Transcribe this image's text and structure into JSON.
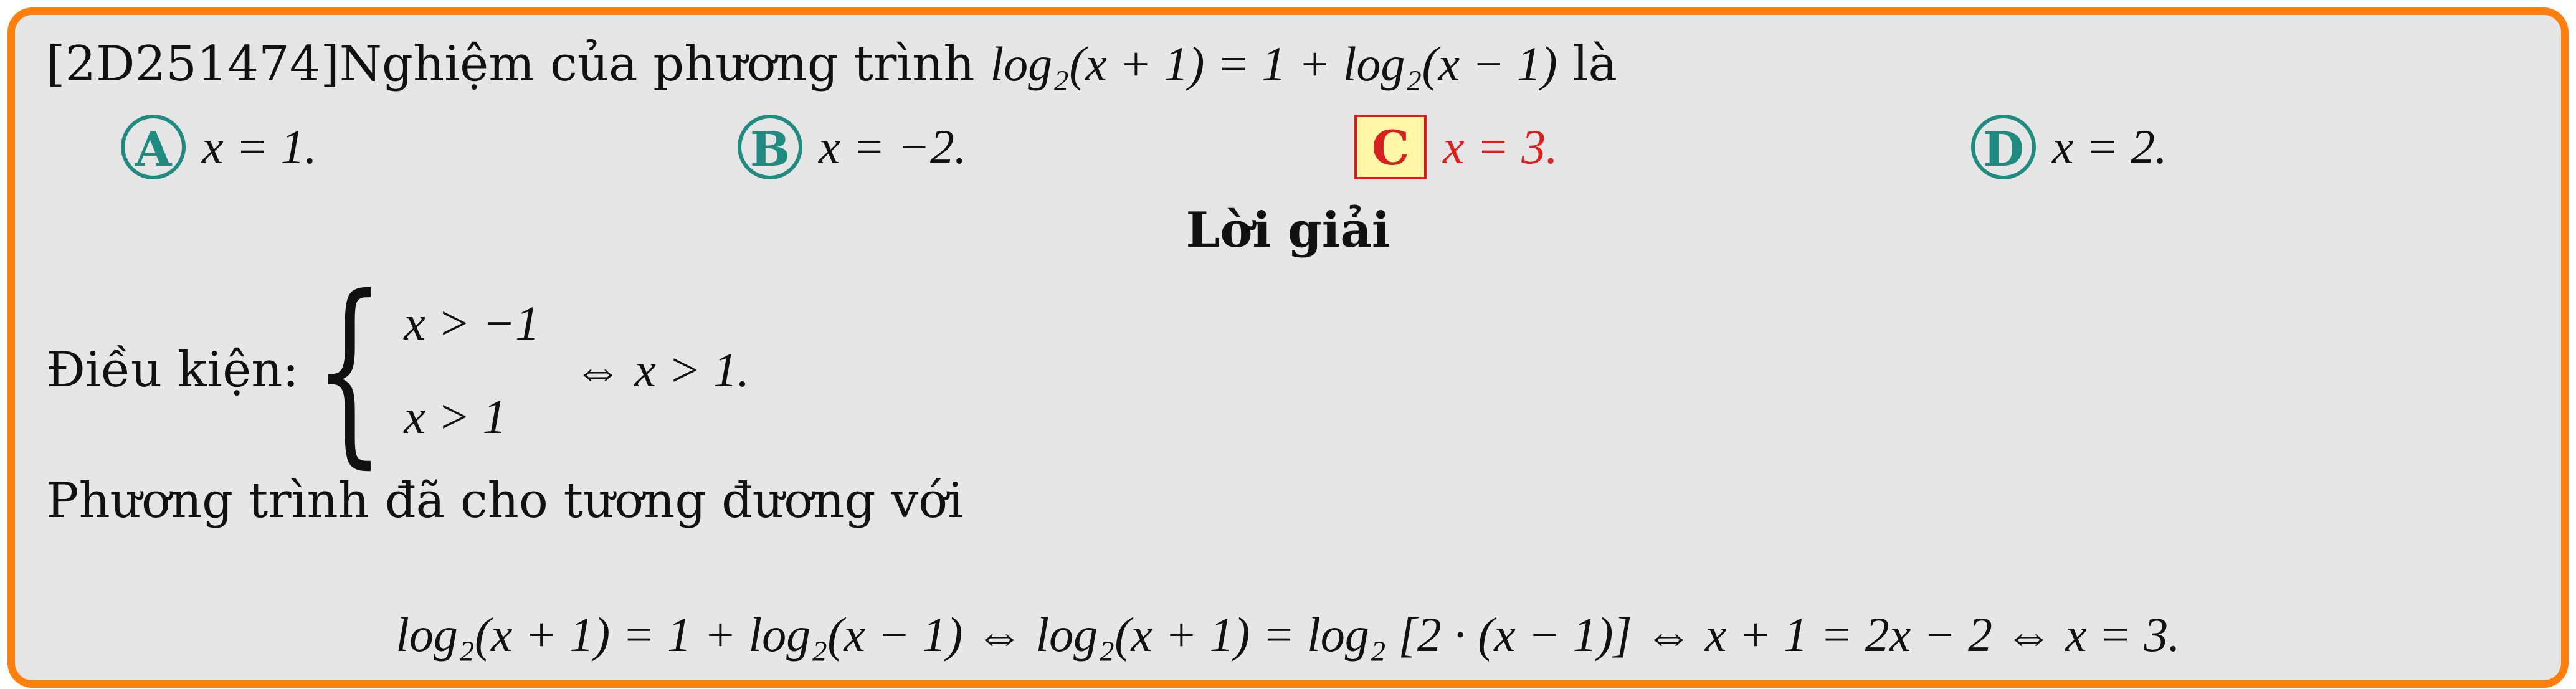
{
  "question": {
    "prefix": "[2D251474]Nghiệm của phương trình ",
    "eq": "log₂(x + 1) = 1 + log₂(x − 1)",
    "suffix": " là"
  },
  "options": [
    {
      "label": "A",
      "text": "x = 1."
    },
    {
      "label": "B",
      "text": "x = −2."
    },
    {
      "label": "C",
      "text": "x = 3."
    },
    {
      "label": "D",
      "text": "x = 2."
    }
  ],
  "solution": {
    "title": "Lời giải",
    "condition_label": "Điều kiện:",
    "conditions": [
      "x > −1",
      "x > 1"
    ],
    "condition_result": "⇔ x > 1.",
    "equivalent_text": "Phương trình đã cho tương đương với",
    "final_eq": "log₂(x + 1) = 1 + log₂(x − 1) ⇔ log₂(x + 1) = log₂ [2 · (x − 1)] ⇔ x + 1 = 2x − 2 ⇔ x = 3."
  },
  "colors": {
    "border": "#ff7f0e",
    "background": "#e6e6e6",
    "option_circle": "#1f8a80",
    "correct": "#e01e1e",
    "correct_fill": "#fff6a6"
  }
}
